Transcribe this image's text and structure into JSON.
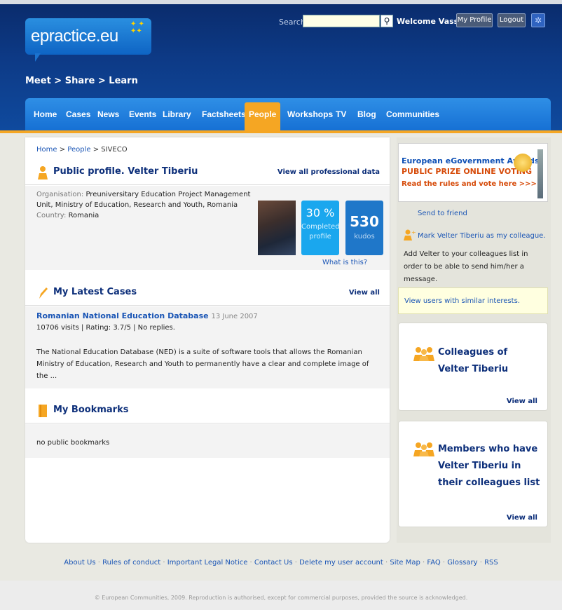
{
  "header": {
    "logo_text": "epractice.eu",
    "tagline": "Meet > Share > Learn",
    "search_label": "Search",
    "search_value": "",
    "welcome": "Welcome Vassilia",
    "my_profile": "My Profile",
    "logout": "Logout"
  },
  "nav": {
    "items": [
      "Home",
      "Cases",
      "News",
      "Events",
      "Library",
      "Factsheets",
      "People",
      "Workshops",
      "TV",
      "Blog",
      "Communities"
    ],
    "active": "People"
  },
  "breadcrumb": {
    "home": "Home",
    "people": "People",
    "current": "SIVECO"
  },
  "profile": {
    "title": "Public profile. Velter Tiberiu",
    "view_all": "View all professional data",
    "org_label": "Organisation:",
    "org_value": "Preuniversitary Education Project Management Unit, Ministry of Education, Research and Youth, Romania",
    "country_label": "Country:",
    "country_value": "Romania",
    "completed_value": "30 %",
    "completed_label_1": "Completed",
    "completed_label_2": "profile",
    "kudos_value": "530",
    "kudos_label": "kudos",
    "what_is_this": "What is this?"
  },
  "cases": {
    "heading": "My Latest Cases",
    "view_all": "View all",
    "item_title": "Romanian National Education Database",
    "item_date": "13 June 2007",
    "item_meta": "10706 visits | Rating: 3.7/5 | No replies.",
    "item_desc": "The National Education Database (NED) is a suite of software tools that allows the Romanian Ministry of Education, Research and Youth to permanently have a clear and complete image of the ..."
  },
  "bookmarks": {
    "heading": "My Bookmarks",
    "empty": "no public bookmarks"
  },
  "sidebar": {
    "award_l1": "European eGovernment Awards",
    "award_l2": "PUBLIC PRIZE ONLINE VOTING",
    "award_l3": "Read the rules and vote here >>>",
    "send": "Send to friend",
    "mark": "Mark Velter Tiberiu as my colleague.",
    "add_text": "Add Velter to your colleagues list in order to be able to send him/her a message.",
    "similar": "View users with similar interests.",
    "colleagues_title": "Colleagues of Velter Tiberiu",
    "colleagues_view_all": "View all",
    "members_title": "Members who have Velter Tiberiu in their colleagues list",
    "members_view_all": "View all"
  },
  "footer": {
    "links": [
      "About Us",
      "Rules of conduct",
      "Important Legal Notice",
      "Contact Us",
      "Delete my user account",
      "Site Map",
      "FAQ",
      "Glossary",
      "RSS"
    ],
    "copyright": "© European Communities, 2009. Reproduction is authorised, except for commercial purposes, provided the source is acknowledged."
  }
}
